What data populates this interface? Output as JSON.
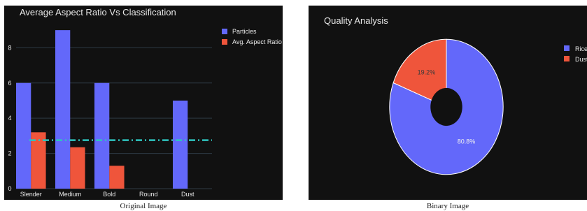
{
  "captions": {
    "left": "Original Image",
    "right": "Binary Image"
  },
  "colors": {
    "panel_bg": "#111111",
    "particles": "#6368fa",
    "aspect": "#ef553b",
    "avg_line": "#2fc5c0",
    "grid": "#2e3a44",
    "text": "#e8e8e8",
    "pie_label_dark": "#3a3a3a",
    "pie_label_light": "#f0f0f0"
  },
  "chart_data": [
    {
      "type": "bar",
      "title": "Average Aspect Ratio Vs Classification",
      "categories": [
        "Slender",
        "Medium",
        "Bold",
        "Round",
        "Dust"
      ],
      "series": [
        {
          "name": "Particles",
          "values": [
            6,
            9,
            6,
            0,
            5
          ]
        },
        {
          "name": "Avg. Aspect Ratio",
          "values": [
            3.2,
            2.35,
            1.3,
            0,
            0
          ]
        }
      ],
      "reference_line": {
        "value": 2.75,
        "style": "dash-dot"
      },
      "yticks": [
        0,
        2,
        4,
        6,
        8
      ],
      "ylim": [
        0,
        9.6
      ],
      "grid": true,
      "legend": "top-right"
    },
    {
      "type": "pie",
      "title": "Quality Analysis",
      "hole": 0.28,
      "labels": [
        "Rice",
        "Dust"
      ],
      "values": [
        80.8,
        19.2
      ],
      "text_labels": [
        "80.8%",
        "19.2%"
      ],
      "legend": "top-right"
    }
  ]
}
